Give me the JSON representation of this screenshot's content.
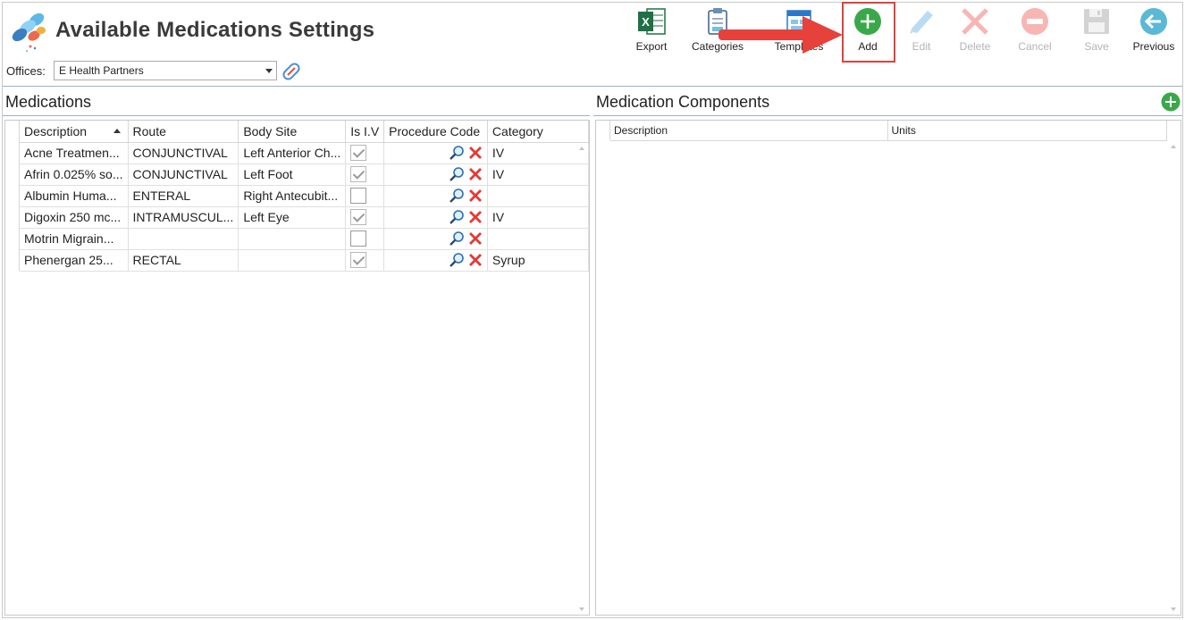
{
  "header": {
    "title": "Available Medications Settings",
    "offices_label": "Offices:",
    "offices_value": "E Health Partners"
  },
  "toolbar": {
    "export": "Export",
    "categories": "Categories",
    "templates": "Templates",
    "add": "Add",
    "edit": "Edit",
    "delete": "Delete",
    "cancel": "Cancel",
    "save": "Save",
    "previous": "Previous"
  },
  "medications": {
    "title": "Medications",
    "columns": [
      "Description",
      "Route",
      "Body Site",
      "Is I.V",
      "Procedure Code",
      "Category"
    ],
    "rows": [
      {
        "description": "Acne Treatmen...",
        "route": "CONJUNCTIVAL",
        "body_site": "Left Anterior Ch...",
        "is_iv": true,
        "category": "IV"
      },
      {
        "description": "Afrin 0.025% so...",
        "route": "CONJUNCTIVAL",
        "body_site": "Left Foot",
        "is_iv": true,
        "category": "IV"
      },
      {
        "description": "Albumin Huma...",
        "route": "ENTERAL",
        "body_site": "Right Antecubit...",
        "is_iv": false,
        "category": ""
      },
      {
        "description": "Digoxin 250 mc...",
        "route": "INTRAMUSCUL...",
        "body_site": "Left Eye",
        "is_iv": true,
        "category": "IV"
      },
      {
        "description": "Motrin Migrain...",
        "route": "",
        "body_site": "",
        "is_iv": false,
        "category": ""
      },
      {
        "description": "Phenergan 25...",
        "route": "RECTAL",
        "body_site": "",
        "is_iv": true,
        "category": "Syrup"
      }
    ]
  },
  "components": {
    "title": "Medication Components",
    "columns": [
      "Description",
      "Units"
    ]
  },
  "colors": {
    "accent_green": "#3aa84a",
    "highlight_red": "#e0423c",
    "delete_red": "#e53935"
  }
}
